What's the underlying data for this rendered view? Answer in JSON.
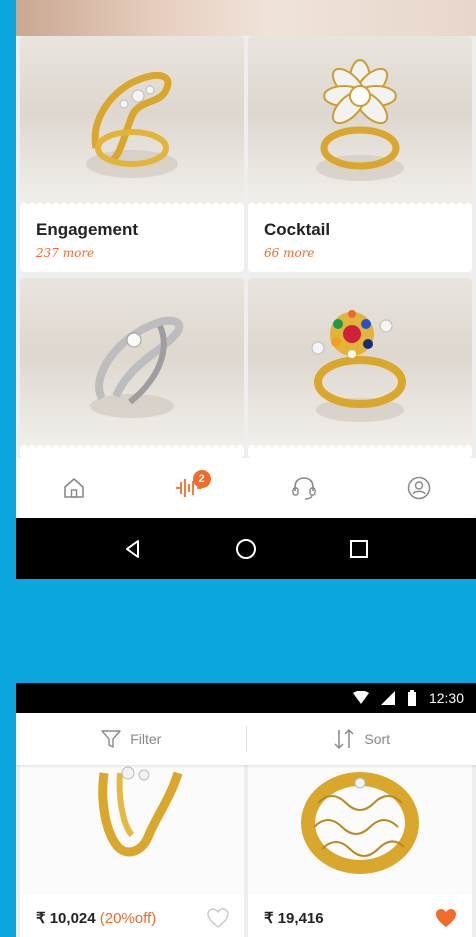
{
  "categories": [
    {
      "title": "Engagement",
      "more": "237 more"
    },
    {
      "title": "Cocktail",
      "more": "66 more"
    },
    {
      "title": "",
      "more": ""
    },
    {
      "title": "",
      "more": ""
    }
  ],
  "bottom_nav": {
    "items": [
      {
        "icon": "home-icon"
      },
      {
        "icon": "trending-icon",
        "badge": "2"
      },
      {
        "icon": "support-icon"
      },
      {
        "icon": "account-icon"
      }
    ]
  },
  "system_nav": [
    "back-icon",
    "home-circle-icon",
    "recents-icon"
  ],
  "status_bar": {
    "time": "12:30"
  },
  "filter_bar": {
    "filter_label": "Filter",
    "sort_label": "Sort"
  },
  "products": [
    {
      "price": "₹ 10,024",
      "discount": "(20%off)",
      "favorited": false
    },
    {
      "price": "₹ 19,416",
      "discount": "",
      "favorited": true
    }
  ],
  "colors": {
    "accent": "#f26b2b",
    "background": "#0aa7dd"
  }
}
